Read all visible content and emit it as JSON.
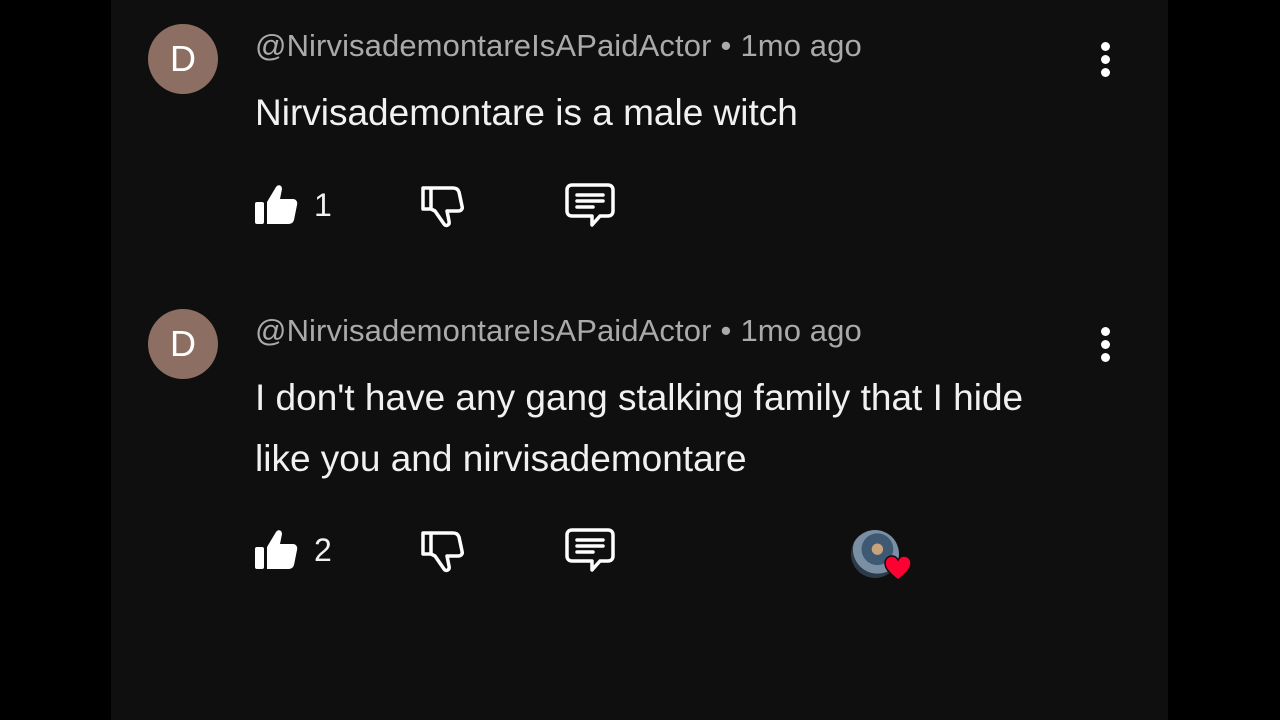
{
  "colors": {
    "page_background": "#0f0f0f",
    "outer_background": "#000000",
    "avatar_background": "#8d6e63",
    "meta_text": "#aaaaaa",
    "body_text": "#f1f1f1",
    "heart": "#ff0033"
  },
  "comments": [
    {
      "avatar_letter": "D",
      "author": "@NirvisademontareIsAPaidActor",
      "separator": "•",
      "time": "1mo ago",
      "text": "Nirvisademontare is a male witch",
      "likes": "1",
      "icons": {
        "like": "thumbs-up-icon",
        "dislike": "thumbs-down-icon",
        "reply": "reply-icon",
        "more": "more-vert-icon"
      }
    },
    {
      "avatar_letter": "D",
      "author": "@NirvisademontareIsAPaidActor",
      "separator": "•",
      "time": "1mo ago",
      "text": "I don't have any gang stalking family that I hide like you and nirvisademontare",
      "likes": "2",
      "creator_hearted": true,
      "icons": {
        "like": "thumbs-up-icon",
        "dislike": "thumbs-down-icon",
        "reply": "reply-icon",
        "more": "more-vert-icon",
        "heart": "heart-icon"
      }
    }
  ]
}
